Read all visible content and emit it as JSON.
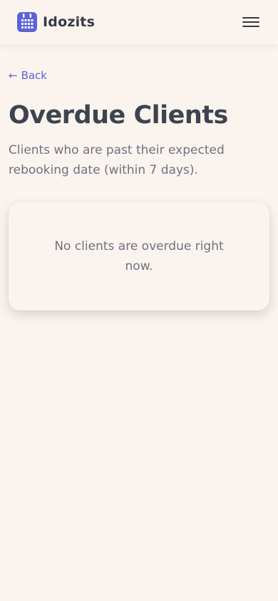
{
  "header": {
    "brand": "Idozits",
    "logo_icon": "calendar-icon",
    "menu_icon": "hamburger-menu-icon",
    "accent_color": "#5b63d6"
  },
  "nav": {
    "back_arrow": "←",
    "back_label": "Back"
  },
  "main": {
    "title": "Overdue Clients",
    "subtitle": "Clients who are past their expected rebooking date (within 7 days).",
    "empty_message": "No clients are overdue right now."
  }
}
